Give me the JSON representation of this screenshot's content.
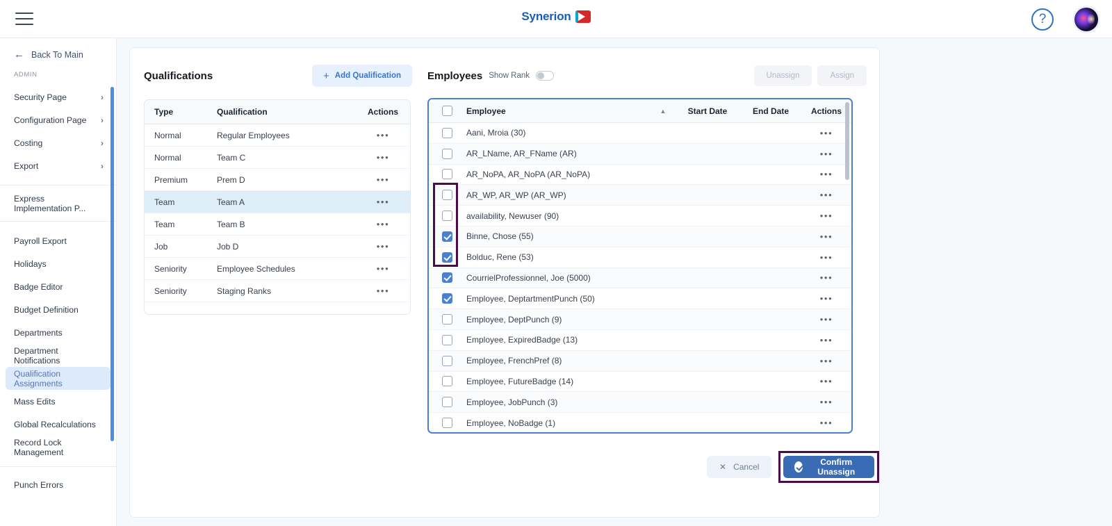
{
  "app": {
    "brand_name": "Synerion",
    "help_icon": "question-mark-icon",
    "menu_icon": "hamburger-menu-icon"
  },
  "sidebar": {
    "back_label": "Back To Main",
    "section_label": "ADMIN",
    "expandable_items": [
      {
        "label": "Security Page",
        "chevron": "›"
      },
      {
        "label": "Configuration Page",
        "chevron": "›"
      },
      {
        "label": "Costing",
        "chevron": "›"
      },
      {
        "label": "Export",
        "chevron": "›"
      }
    ],
    "express_item": {
      "label": "Express Implementation P..."
    },
    "items": [
      {
        "label": "Payroll Export",
        "active": false
      },
      {
        "label": "Holidays",
        "active": false
      },
      {
        "label": "Badge Editor",
        "active": false
      },
      {
        "label": "Budget Definition",
        "active": false
      },
      {
        "label": "Departments",
        "active": false
      },
      {
        "label": "Department Notifications",
        "active": false
      },
      {
        "label": "Qualification Assignments",
        "active": true
      },
      {
        "label": "Mass Edits",
        "active": false
      },
      {
        "label": "Global Recalculations",
        "active": false
      },
      {
        "label": "Record Lock Management",
        "active": false
      }
    ],
    "bottom_items": [
      {
        "label": "Punch Errors",
        "active": false
      }
    ]
  },
  "qualifications": {
    "title": "Qualifications",
    "add_button_label": "Add Qualification",
    "add_button_icon": "plus-icon",
    "columns": [
      "Type",
      "Qualification",
      "Actions"
    ],
    "rows": [
      {
        "type": "Normal",
        "qualification": "Regular Employees",
        "selected": false
      },
      {
        "type": "Normal",
        "qualification": "Team C",
        "selected": false
      },
      {
        "type": "Premium",
        "qualification": "Prem D",
        "selected": false
      },
      {
        "type": "Team",
        "qualification": "Team A",
        "selected": true
      },
      {
        "type": "Team",
        "qualification": "Team B",
        "selected": false
      },
      {
        "type": "Job",
        "qualification": "Job D",
        "selected": false
      },
      {
        "type": "Seniority",
        "qualification": "Employee Schedules",
        "selected": false
      },
      {
        "type": "Seniority",
        "qualification": "Staging Ranks",
        "selected": false
      }
    ],
    "row_action_icon": "ellipsis-icon"
  },
  "employees": {
    "title": "Employees",
    "show_rank_label": "Show Rank",
    "show_rank_on": false,
    "unassign_label": "Unassign",
    "assign_label": "Assign",
    "columns": {
      "employee": "Employee",
      "start_date": "Start Date",
      "end_date": "End Date",
      "actions": "Actions"
    },
    "sort_indicator": "▲",
    "header_checkbox_checked": false,
    "rows": [
      {
        "name": "Aani, Mroia (30)",
        "checked": false,
        "start_date": "",
        "end_date": ""
      },
      {
        "name": "AR_LName, AR_FName (AR)",
        "checked": false,
        "start_date": "",
        "end_date": ""
      },
      {
        "name": "AR_NoPA, AR_NoPA (AR_NoPA)",
        "checked": false,
        "start_date": "",
        "end_date": ""
      },
      {
        "name": "AR_WP, AR_WP (AR_WP)",
        "checked": false,
        "start_date": "",
        "end_date": ""
      },
      {
        "name": "availability, Newuser (90)",
        "checked": false,
        "start_date": "",
        "end_date": ""
      },
      {
        "name": "Binne, Chose (55)",
        "checked": true,
        "start_date": "",
        "end_date": ""
      },
      {
        "name": "Bolduc, Rene (53)",
        "checked": true,
        "start_date": "",
        "end_date": ""
      },
      {
        "name": "CourrielProfessionnel, Joe (5000)",
        "checked": true,
        "start_date": "",
        "end_date": ""
      },
      {
        "name": "Employee, DeptartmentPunch (50)",
        "checked": true,
        "start_date": "",
        "end_date": ""
      },
      {
        "name": "Employee, DeptPunch (9)",
        "checked": false,
        "start_date": "",
        "end_date": ""
      },
      {
        "name": "Employee, ExpiredBadge (13)",
        "checked": false,
        "start_date": "",
        "end_date": ""
      },
      {
        "name": "Employee, FrenchPref (8)",
        "checked": false,
        "start_date": "",
        "end_date": ""
      },
      {
        "name": "Employee, FutureBadge (14)",
        "checked": false,
        "start_date": "",
        "end_date": ""
      },
      {
        "name": "Employee, JobPunch (3)",
        "checked": false,
        "start_date": "",
        "end_date": ""
      },
      {
        "name": "Employee, NoBadge (1)",
        "checked": false,
        "start_date": "",
        "end_date": ""
      }
    ],
    "row_action_icon": "ellipsis-icon"
  },
  "footer": {
    "cancel_label": "Cancel",
    "cancel_icon": "close-x-icon",
    "confirm_label": "Confirm Unassign",
    "confirm_icon": "check-circle-icon"
  },
  "colors": {
    "brand_blue": "#1a5fb4",
    "accent_blue": "#4a7fd1",
    "primary_button": "#3a6bb5",
    "highlight_outline": "#4a0d4a",
    "selected_row": "#ddeef9",
    "page_bg": "#f6f9fc"
  }
}
